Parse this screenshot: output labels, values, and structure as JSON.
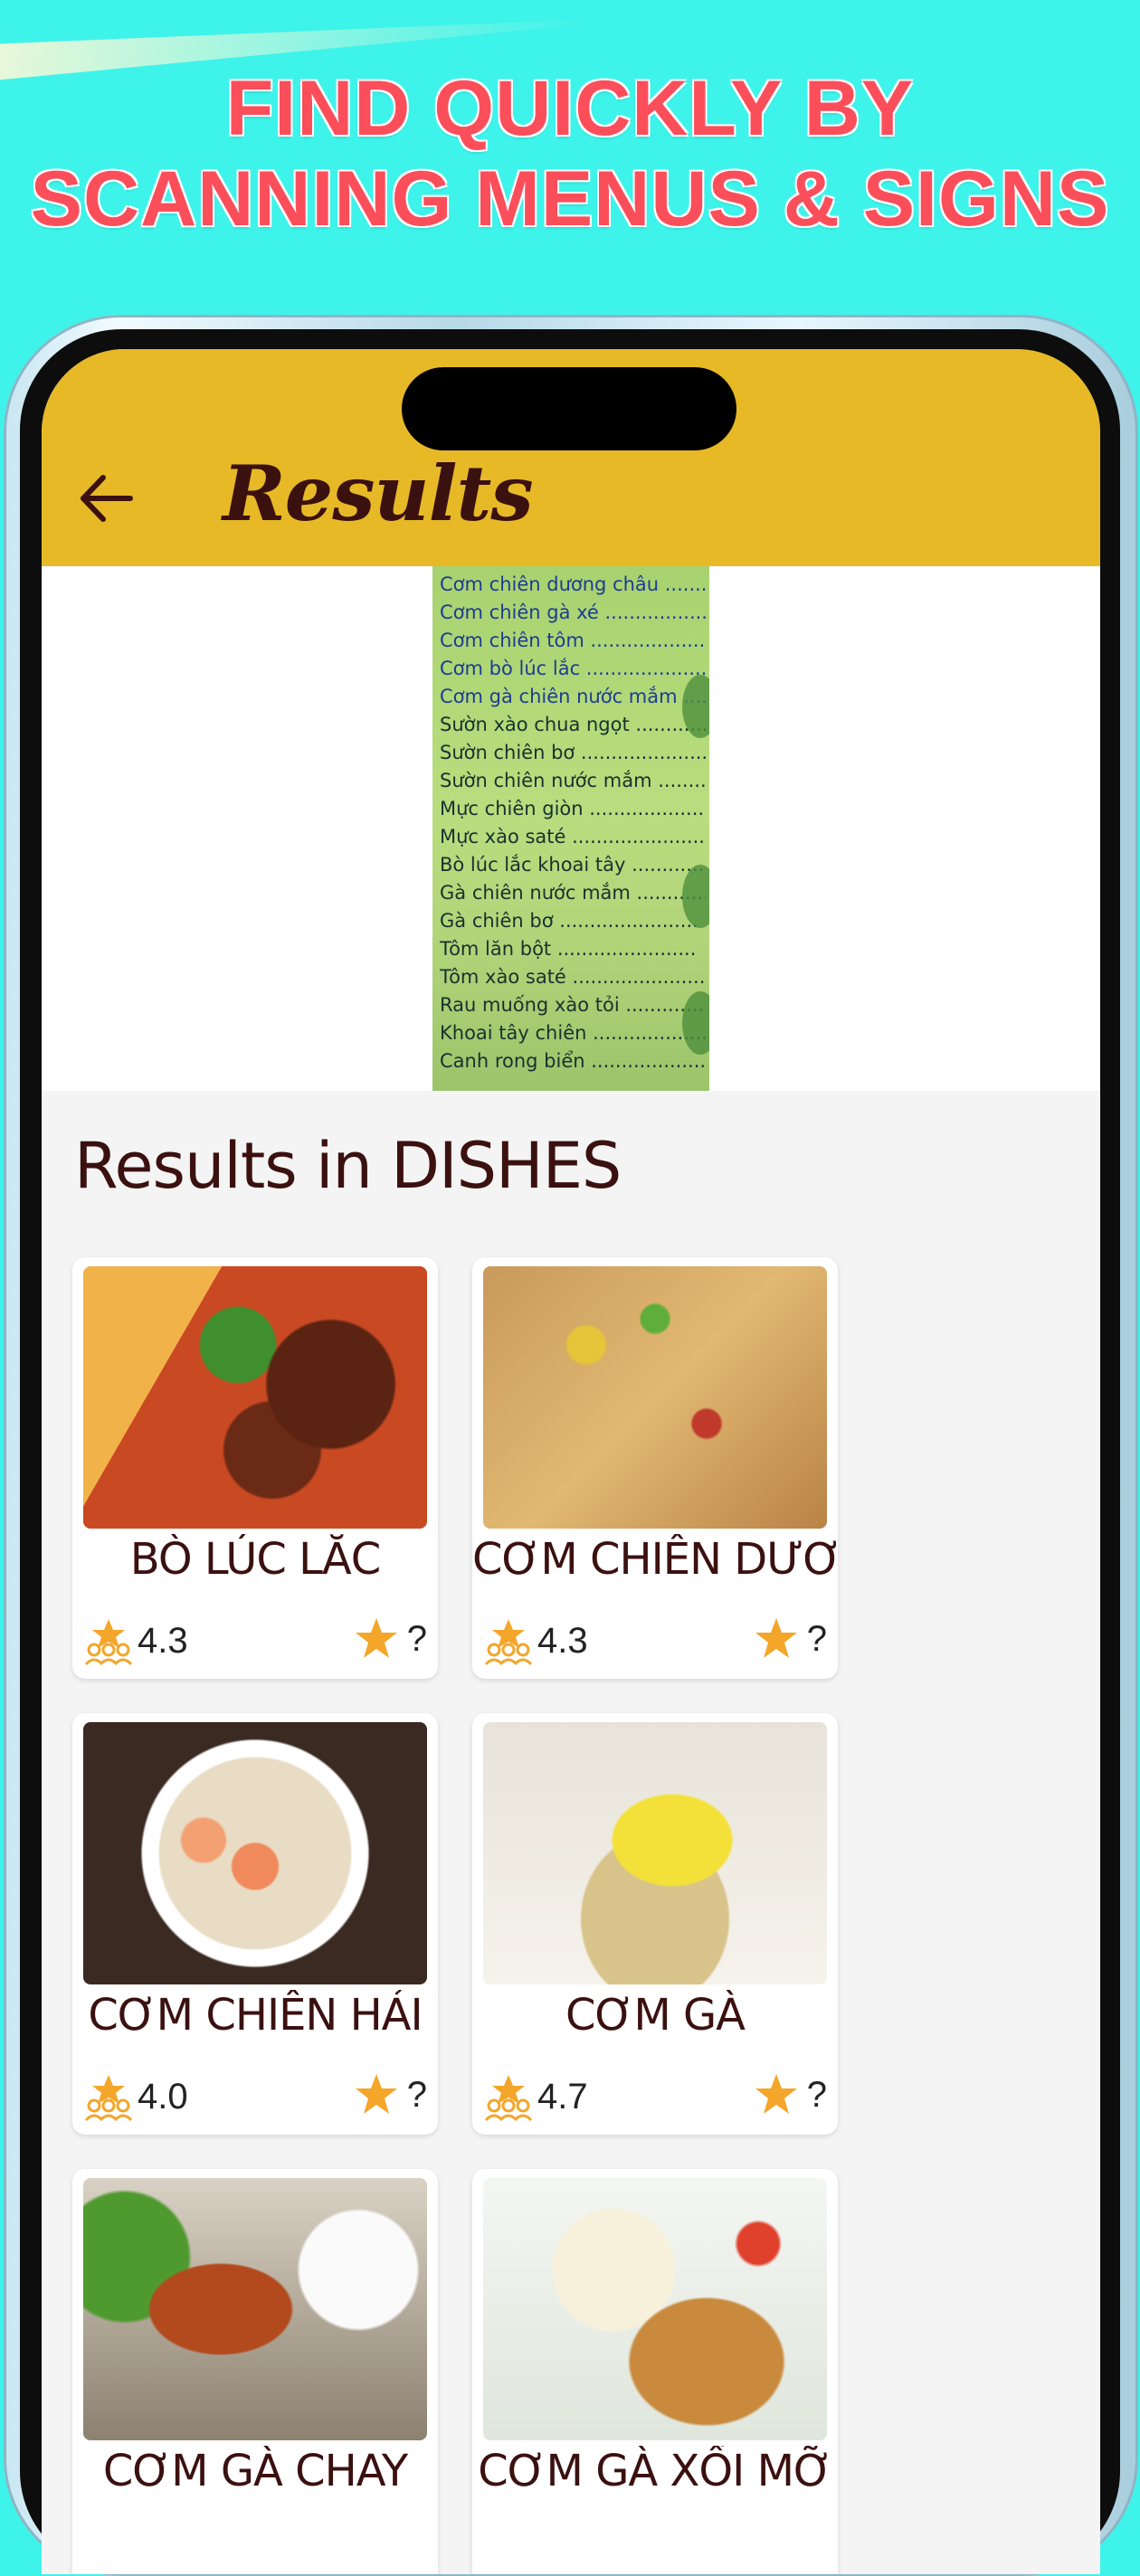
{
  "promo": {
    "line1": "FIND QUICKLY BY",
    "line2": "SCANNING MENUS & SIGNS"
  },
  "header": {
    "title": "Results",
    "back_icon": "arrow-left-icon",
    "background_color": "#e7b927"
  },
  "scan_image": {
    "lines": [
      "Cơm chiên dương châu",
      "Cơm chiên gà xé",
      "Cơm chiên tôm",
      "Cơm bò lúc lắc",
      "Cơm gà chiên nước mắm",
      "Sườn xào chua ngọt",
      "Sườn chiên bơ",
      "Sườn chiên nước mắm",
      "Mực chiên giòn",
      "Mực xào saté",
      "Bò lúc lắc khoai tây",
      "Gà chiên nước mắm",
      "Gà chiên bơ",
      "Tôm lăn bột",
      "Tôm xào saté",
      "Rau muống xào tỏi",
      "Khoai tây chiên",
      "Canh rong biển"
    ]
  },
  "results": {
    "section_title": "Results in DISHES",
    "dishes": [
      {
        "name": "BÒ LÚC LẮC",
        "community_rating": "4.3",
        "user_rating": "?"
      },
      {
        "name": "CƠM CHIÊN DƯƠNG",
        "community_rating": "4.3",
        "user_rating": "?"
      },
      {
        "name": "CƠM CHIÊN HẢI",
        "community_rating": "4.0",
        "user_rating": "?"
      },
      {
        "name": "CƠM GÀ",
        "community_rating": "4.7",
        "user_rating": "?"
      },
      {
        "name": "CƠM GÀ CHAY",
        "community_rating": "",
        "user_rating": ""
      },
      {
        "name": "CƠM GÀ XỐI MỠ",
        "community_rating": "",
        "user_rating": ""
      }
    ]
  },
  "colors": {
    "background": "#3ef3ea",
    "promo_text": "#fb4e5b",
    "star": "#f4a62a",
    "title_text": "#3b1110"
  }
}
